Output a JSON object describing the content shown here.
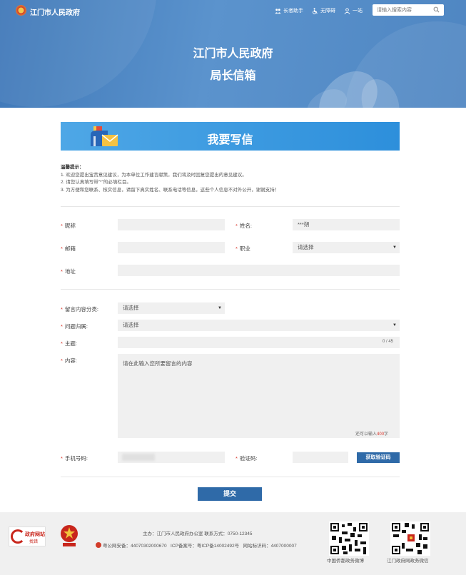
{
  "header": {
    "site_name": "江门市人民政府",
    "tools": {
      "elder_mode": "长者助手",
      "accessible": "无障碍",
      "one_net": "一站"
    },
    "search": {
      "placeholder": "请输入搜索内容",
      "icon": "search-icon"
    },
    "hero_title": "江门市人民政府",
    "hero_subtitle": "局长信箱"
  },
  "banner": {
    "title": "我要写信",
    "icon": "mailbox-envelope-icon"
  },
  "notice": {
    "heading": "温馨提示：",
    "lines": [
      "1. 欢迎您提出宝贵意见建议，为本单位工作建言献策，我们将及时回复您提出的意见建议。",
      "2. 请您认真填写带\"*\"的必填栏目。",
      "3. 为方便和您联系、核实信息，请留下真实姓名、联系电话等信息，这些个人信息不对外公开，谢谢支持！"
    ]
  },
  "form": {
    "nickname": {
      "label": "昵称",
      "value": ""
    },
    "name": {
      "label": "姓名:",
      "value": "***朔"
    },
    "email": {
      "label": "邮箱",
      "value": ""
    },
    "occupation": {
      "label": "职业",
      "selected": "请选择"
    },
    "address": {
      "label": "地址",
      "value": ""
    },
    "category": {
      "label": "留言内容分类:",
      "selected": "请选择"
    },
    "topic": {
      "label": "问题归属:",
      "selected": "请选择"
    },
    "subject": {
      "label": "主题:",
      "value": "",
      "counter": "0 / 45"
    },
    "content": {
      "label": "内容:",
      "placeholder": "请在此输入您所要留言的内容",
      "counter_prefix": "还可以输入",
      "counter_value": "400",
      "counter_suffix": "字"
    },
    "phone": {
      "label": "手机号码:",
      "value": ""
    },
    "captcha": {
      "label": "验证码:",
      "value": ""
    },
    "get_code_label": "获取验证码",
    "submit_label": "提交",
    "required_mark": "*"
  },
  "footer": {
    "badge1_title": "政府网站",
    "badge1_sub": "找错",
    "host_line": "主办：江门市人民政府办公室   联系方式：0750-12345",
    "record_police": "粤公网安备：44070302000670",
    "record_icp": "ICP备案号：粤ICP备14002492号",
    "record_site": "网站标识码：4407000007",
    "qr1_caption": "中国侨都政务微博",
    "qr2_caption": "江门政府网政务微信"
  },
  "colors": {
    "hero_blue": "#4f86c2",
    "banner_blue": "#2d8fdb",
    "button_blue": "#2f6aa8",
    "required_red": "#d9362b",
    "field_gray": "#f0f0f0"
  }
}
